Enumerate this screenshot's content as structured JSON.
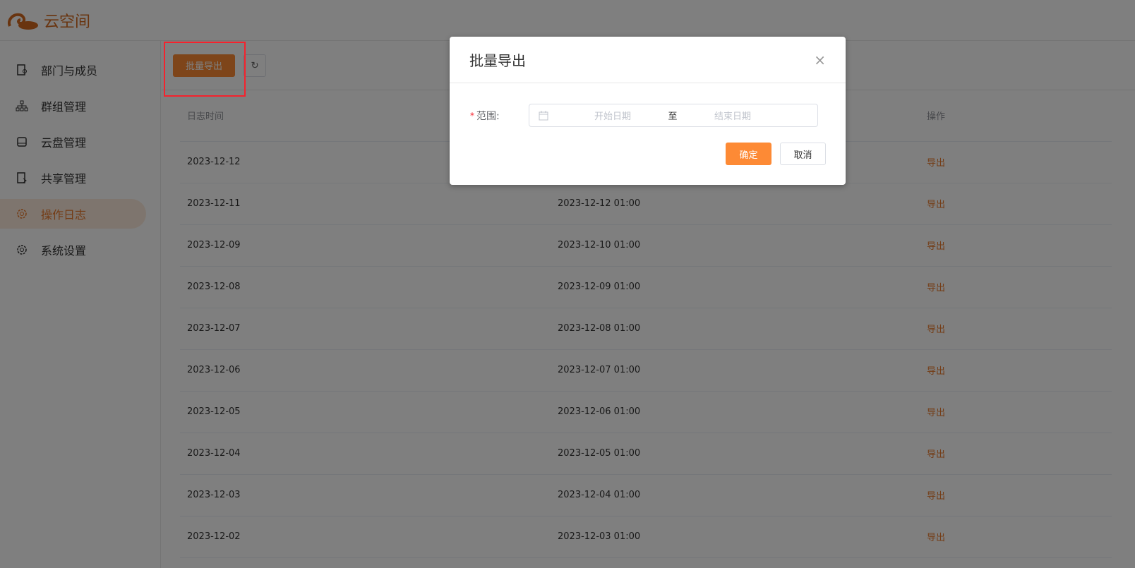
{
  "app": {
    "name": "云空间"
  },
  "sidebar": {
    "items": [
      {
        "label": "部门与成员"
      },
      {
        "label": "群组管理"
      },
      {
        "label": "云盘管理"
      },
      {
        "label": "共享管理"
      },
      {
        "label": "操作日志"
      },
      {
        "label": "系统设置"
      }
    ]
  },
  "toolbar": {
    "export_label": "批量导出",
    "refresh_icon": "↻"
  },
  "table": {
    "headers": [
      "日志时间",
      "",
      "操作"
    ],
    "rows": [
      [
        "2023-12-12",
        "",
        "导出"
      ],
      [
        "2023-12-11",
        "2023-12-12 01:00",
        "导出"
      ],
      [
        "2023-12-09",
        "2023-12-10 01:00",
        "导出"
      ],
      [
        "2023-12-08",
        "2023-12-09 01:00",
        "导出"
      ],
      [
        "2023-12-07",
        "2023-12-08 01:00",
        "导出"
      ],
      [
        "2023-12-06",
        "2023-12-07 01:00",
        "导出"
      ],
      [
        "2023-12-05",
        "2023-12-06 01:00",
        "导出"
      ],
      [
        "2023-12-04",
        "2023-12-05 01:00",
        "导出"
      ],
      [
        "2023-12-03",
        "2023-12-04 01:00",
        "导出"
      ],
      [
        "2023-12-02",
        "2023-12-03 01:00",
        "导出"
      ]
    ]
  },
  "modal": {
    "title": "批量导出",
    "close": "×",
    "required_mark": "*",
    "label": "范围:",
    "start_placeholder": "开始日期",
    "separator": "至",
    "end_placeholder": "结束日期",
    "ok": "确定",
    "cancel": "取消"
  },
  "colors": {
    "accent": "#fd8a35"
  }
}
